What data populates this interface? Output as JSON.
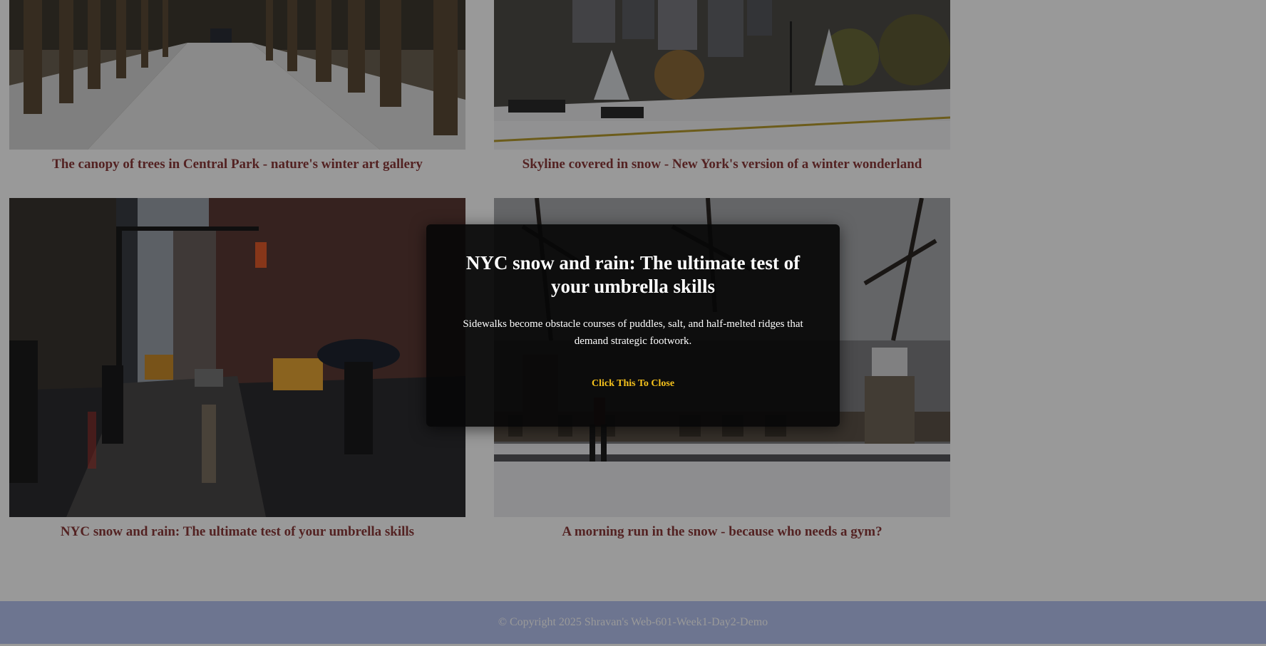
{
  "gallery": {
    "items": [
      {
        "caption": "The canopy of trees in Central Park - nature's winter art gallery"
      },
      {
        "caption": "Skyline covered in snow - New York's version of a winter wonderland"
      },
      {
        "caption": "NYC snow and rain: The ultimate test of your umbrella skills"
      },
      {
        "caption": "A morning run in the snow - because who needs a gym?"
      }
    ]
  },
  "modal": {
    "title": "NYC snow and rain: The ultimate test of your umbrella skills",
    "description": "Sidewalks become obstacle courses of puddles, salt, and half-melted ridges that demand strategic footwork.",
    "close_label": "Click This To Close"
  },
  "footer": {
    "text": "© Copyright 2025 Shravan's Web-601-Week1-Day2-Demo"
  },
  "colors": {
    "caption": "#8b3a3a",
    "footer_bg": "#b6c3f0",
    "close_link": "#f6c21c"
  }
}
